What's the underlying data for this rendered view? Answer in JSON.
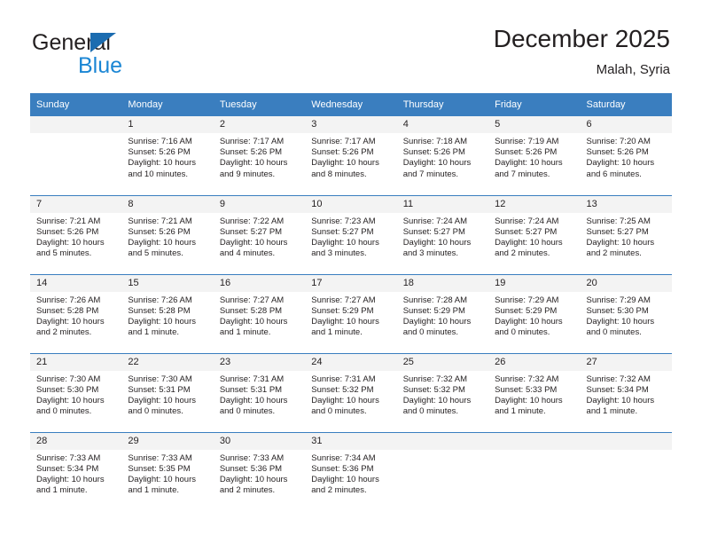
{
  "brand": {
    "name_top": "General",
    "name_bottom": "Blue",
    "accent_blue": "#1b6cb0",
    "light_blue": "#1b86d4"
  },
  "header": {
    "title": "December 2025",
    "subtitle": "Malah, Syria"
  },
  "theme": {
    "header_bg": "#3a7ebf",
    "daynum_bg": "#f3f3f3",
    "text": "#231f20"
  },
  "weekdays": [
    "Sunday",
    "Monday",
    "Tuesday",
    "Wednesday",
    "Thursday",
    "Friday",
    "Saturday"
  ],
  "weeks": [
    [
      {
        "day": "",
        "blank": true,
        "sunrise": "",
        "sunset": "",
        "daylight1": "",
        "daylight2": ""
      },
      {
        "day": "1",
        "sunrise": "Sunrise: 7:16 AM",
        "sunset": "Sunset: 5:26 PM",
        "daylight1": "Daylight: 10 hours",
        "daylight2": "and 10 minutes."
      },
      {
        "day": "2",
        "sunrise": "Sunrise: 7:17 AM",
        "sunset": "Sunset: 5:26 PM",
        "daylight1": "Daylight: 10 hours",
        "daylight2": "and 9 minutes."
      },
      {
        "day": "3",
        "sunrise": "Sunrise: 7:17 AM",
        "sunset": "Sunset: 5:26 PM",
        "daylight1": "Daylight: 10 hours",
        "daylight2": "and 8 minutes."
      },
      {
        "day": "4",
        "sunrise": "Sunrise: 7:18 AM",
        "sunset": "Sunset: 5:26 PM",
        "daylight1": "Daylight: 10 hours",
        "daylight2": "and 7 minutes."
      },
      {
        "day": "5",
        "sunrise": "Sunrise: 7:19 AM",
        "sunset": "Sunset: 5:26 PM",
        "daylight1": "Daylight: 10 hours",
        "daylight2": "and 7 minutes."
      },
      {
        "day": "6",
        "sunrise": "Sunrise: 7:20 AM",
        "sunset": "Sunset: 5:26 PM",
        "daylight1": "Daylight: 10 hours",
        "daylight2": "and 6 minutes."
      }
    ],
    [
      {
        "day": "7",
        "sunrise": "Sunrise: 7:21 AM",
        "sunset": "Sunset: 5:26 PM",
        "daylight1": "Daylight: 10 hours",
        "daylight2": "and 5 minutes."
      },
      {
        "day": "8",
        "sunrise": "Sunrise: 7:21 AM",
        "sunset": "Sunset: 5:26 PM",
        "daylight1": "Daylight: 10 hours",
        "daylight2": "and 5 minutes."
      },
      {
        "day": "9",
        "sunrise": "Sunrise: 7:22 AM",
        "sunset": "Sunset: 5:27 PM",
        "daylight1": "Daylight: 10 hours",
        "daylight2": "and 4 minutes."
      },
      {
        "day": "10",
        "sunrise": "Sunrise: 7:23 AM",
        "sunset": "Sunset: 5:27 PM",
        "daylight1": "Daylight: 10 hours",
        "daylight2": "and 3 minutes."
      },
      {
        "day": "11",
        "sunrise": "Sunrise: 7:24 AM",
        "sunset": "Sunset: 5:27 PM",
        "daylight1": "Daylight: 10 hours",
        "daylight2": "and 3 minutes."
      },
      {
        "day": "12",
        "sunrise": "Sunrise: 7:24 AM",
        "sunset": "Sunset: 5:27 PM",
        "daylight1": "Daylight: 10 hours",
        "daylight2": "and 2 minutes."
      },
      {
        "day": "13",
        "sunrise": "Sunrise: 7:25 AM",
        "sunset": "Sunset: 5:27 PM",
        "daylight1": "Daylight: 10 hours",
        "daylight2": "and 2 minutes."
      }
    ],
    [
      {
        "day": "14",
        "sunrise": "Sunrise: 7:26 AM",
        "sunset": "Sunset: 5:28 PM",
        "daylight1": "Daylight: 10 hours",
        "daylight2": "and 2 minutes."
      },
      {
        "day": "15",
        "sunrise": "Sunrise: 7:26 AM",
        "sunset": "Sunset: 5:28 PM",
        "daylight1": "Daylight: 10 hours",
        "daylight2": "and 1 minute."
      },
      {
        "day": "16",
        "sunrise": "Sunrise: 7:27 AM",
        "sunset": "Sunset: 5:28 PM",
        "daylight1": "Daylight: 10 hours",
        "daylight2": "and 1 minute."
      },
      {
        "day": "17",
        "sunrise": "Sunrise: 7:27 AM",
        "sunset": "Sunset: 5:29 PM",
        "daylight1": "Daylight: 10 hours",
        "daylight2": "and 1 minute."
      },
      {
        "day": "18",
        "sunrise": "Sunrise: 7:28 AM",
        "sunset": "Sunset: 5:29 PM",
        "daylight1": "Daylight: 10 hours",
        "daylight2": "and 0 minutes."
      },
      {
        "day": "19",
        "sunrise": "Sunrise: 7:29 AM",
        "sunset": "Sunset: 5:29 PM",
        "daylight1": "Daylight: 10 hours",
        "daylight2": "and 0 minutes."
      },
      {
        "day": "20",
        "sunrise": "Sunrise: 7:29 AM",
        "sunset": "Sunset: 5:30 PM",
        "daylight1": "Daylight: 10 hours",
        "daylight2": "and 0 minutes."
      }
    ],
    [
      {
        "day": "21",
        "sunrise": "Sunrise: 7:30 AM",
        "sunset": "Sunset: 5:30 PM",
        "daylight1": "Daylight: 10 hours",
        "daylight2": "and 0 minutes."
      },
      {
        "day": "22",
        "sunrise": "Sunrise: 7:30 AM",
        "sunset": "Sunset: 5:31 PM",
        "daylight1": "Daylight: 10 hours",
        "daylight2": "and 0 minutes."
      },
      {
        "day": "23",
        "sunrise": "Sunrise: 7:31 AM",
        "sunset": "Sunset: 5:31 PM",
        "daylight1": "Daylight: 10 hours",
        "daylight2": "and 0 minutes."
      },
      {
        "day": "24",
        "sunrise": "Sunrise: 7:31 AM",
        "sunset": "Sunset: 5:32 PM",
        "daylight1": "Daylight: 10 hours",
        "daylight2": "and 0 minutes."
      },
      {
        "day": "25",
        "sunrise": "Sunrise: 7:32 AM",
        "sunset": "Sunset: 5:32 PM",
        "daylight1": "Daylight: 10 hours",
        "daylight2": "and 0 minutes."
      },
      {
        "day": "26",
        "sunrise": "Sunrise: 7:32 AM",
        "sunset": "Sunset: 5:33 PM",
        "daylight1": "Daylight: 10 hours",
        "daylight2": "and 1 minute."
      },
      {
        "day": "27",
        "sunrise": "Sunrise: 7:32 AM",
        "sunset": "Sunset: 5:34 PM",
        "daylight1": "Daylight: 10 hours",
        "daylight2": "and 1 minute."
      }
    ],
    [
      {
        "day": "28",
        "sunrise": "Sunrise: 7:33 AM",
        "sunset": "Sunset: 5:34 PM",
        "daylight1": "Daylight: 10 hours",
        "daylight2": "and 1 minute."
      },
      {
        "day": "29",
        "sunrise": "Sunrise: 7:33 AM",
        "sunset": "Sunset: 5:35 PM",
        "daylight1": "Daylight: 10 hours",
        "daylight2": "and 1 minute."
      },
      {
        "day": "30",
        "sunrise": "Sunrise: 7:33 AM",
        "sunset": "Sunset: 5:36 PM",
        "daylight1": "Daylight: 10 hours",
        "daylight2": "and 2 minutes."
      },
      {
        "day": "31",
        "sunrise": "Sunrise: 7:34 AM",
        "sunset": "Sunset: 5:36 PM",
        "daylight1": "Daylight: 10 hours",
        "daylight2": "and 2 minutes."
      },
      {
        "day": "",
        "blank": true,
        "sunrise": "",
        "sunset": "",
        "daylight1": "",
        "daylight2": ""
      },
      {
        "day": "",
        "blank": true,
        "sunrise": "",
        "sunset": "",
        "daylight1": "",
        "daylight2": ""
      },
      {
        "day": "",
        "blank": true,
        "sunrise": "",
        "sunset": "",
        "daylight1": "",
        "daylight2": ""
      }
    ]
  ]
}
